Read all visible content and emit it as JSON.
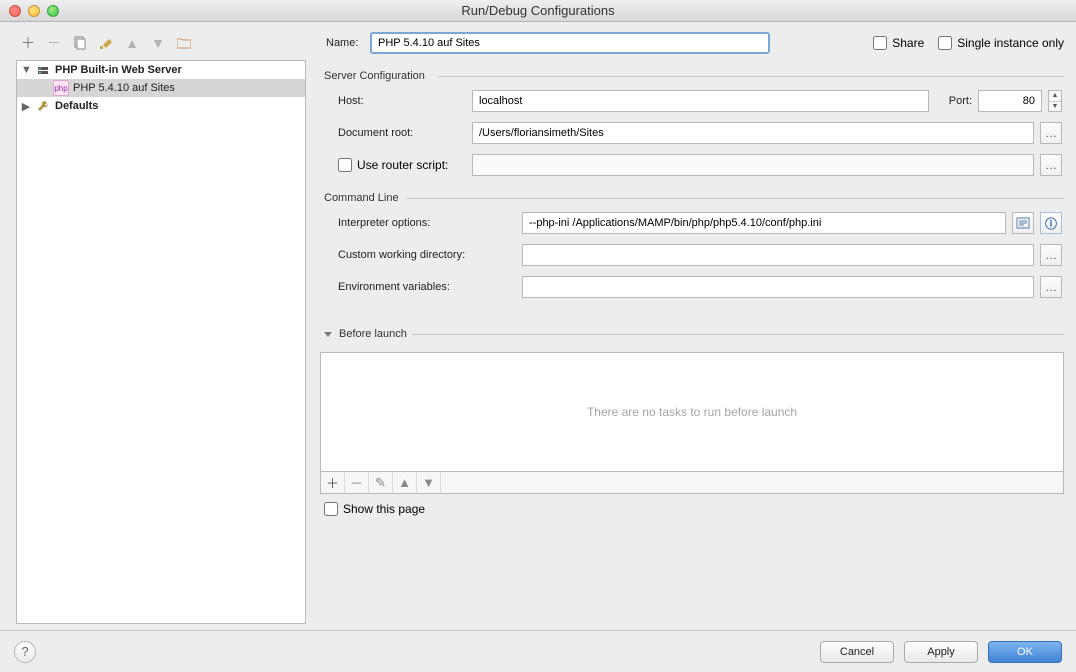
{
  "window": {
    "title": "Run/Debug Configurations"
  },
  "tree": {
    "root": {
      "label": "PHP Built-in Web Server"
    },
    "child": {
      "label": "PHP 5.4.10 auf Sites"
    },
    "defaults": {
      "label": "Defaults"
    }
  },
  "name": {
    "label": "Name:",
    "value": "PHP 5.4.10 auf Sites",
    "share": "Share",
    "single": "Single instance only"
  },
  "server": {
    "legend": "Server Configuration",
    "host_label": "Host:",
    "host": "localhost",
    "port_label": "Port:",
    "port": "80",
    "docroot_label": "Document root:",
    "docroot": "/Users/floriansimeth/Sites",
    "router_label": "Use router script:",
    "router": ""
  },
  "cmd": {
    "legend": "Command Line",
    "interp_label": "Interpreter options:",
    "interp": "--php-ini /Applications/MAMP/bin/php/php5.4.10/conf/php.ini",
    "cwd_label": "Custom working directory:",
    "cwd": "",
    "env_label": "Environment variables:",
    "env": ""
  },
  "before": {
    "legend": "Before launch",
    "empty": "There are no tasks to run before launch",
    "show": "Show this page"
  },
  "footer": {
    "cancel": "Cancel",
    "apply": "Apply",
    "ok": "OK"
  }
}
